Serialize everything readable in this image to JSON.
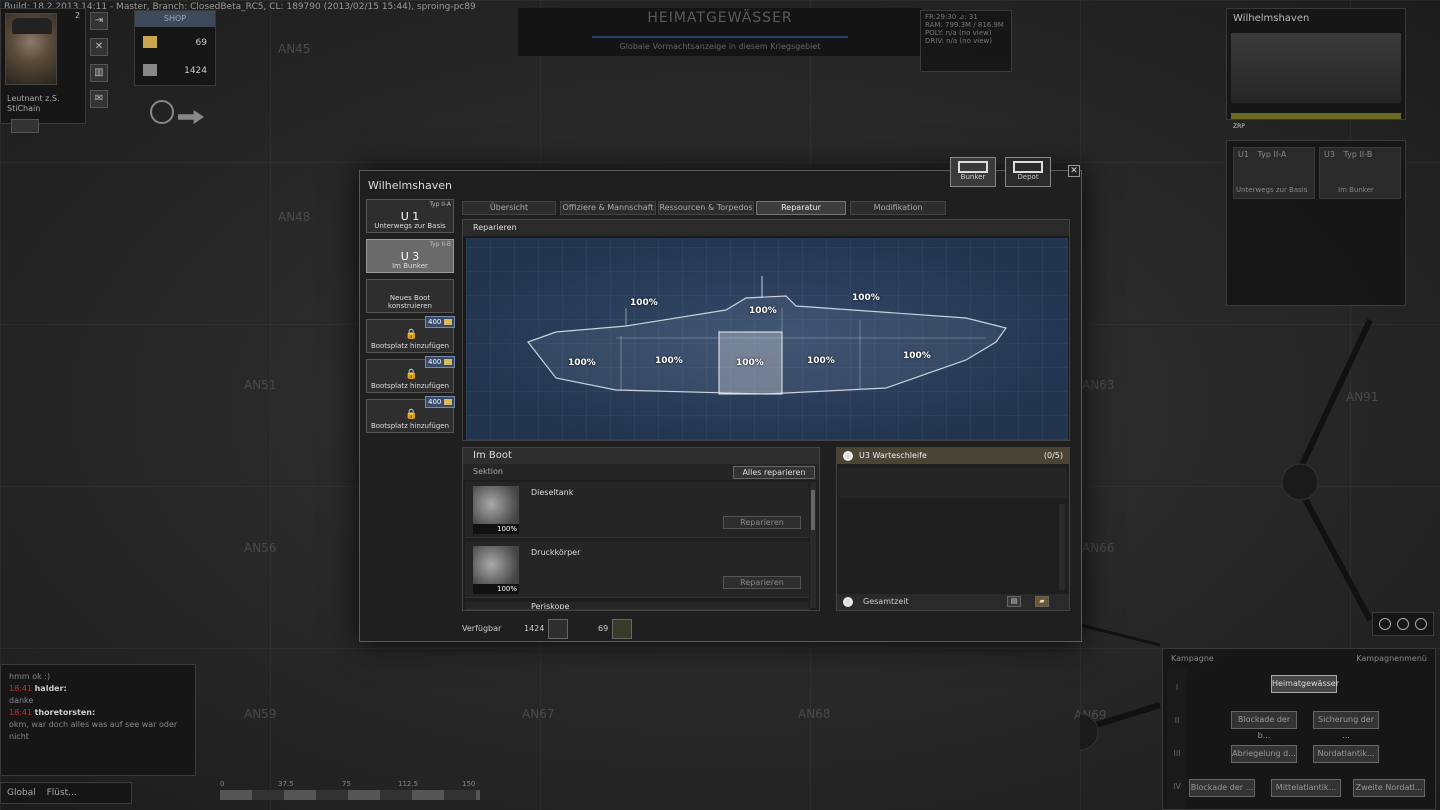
{
  "build_info": "Build: 18.2.2013 14:11 - Master, Branch: ClosedBeta_RC5, CL: 189790 (2013/02/15 15:44), sproing-pc89",
  "map": {
    "labels": [
      "AN45",
      "AN48",
      "AN51",
      "AN56",
      "AN59",
      "AN67",
      "AN68",
      "AN63",
      "AN66",
      "AN91",
      "AN69"
    ]
  },
  "officer": {
    "rank": "Leutnant z.S.",
    "name": "StiChain",
    "level": "2"
  },
  "shop": {
    "tab": "SHOP",
    "gold": "69",
    "credits": "1424"
  },
  "region": {
    "title": "HEIMATGEWÄSSER",
    "subtitle": "Globale Vormachtsanzeige in diesem Kriegsgebiet"
  },
  "debug": {
    "lines": [
      "FR:29:30  ⊿: 31",
      "",
      "RAM:   799.3M / 816.9M",
      "POLY:  n/a (no view)",
      "DRIV:  n/a (no view)"
    ]
  },
  "port_panel": {
    "title": "Wilhelmshaven",
    "bar_label": "ZRP"
  },
  "boats_panel": {
    "cards": [
      {
        "id": "U1",
        "type": "Typ II-A",
        "status": "Unterwegs zur Basis"
      },
      {
        "id": "U3",
        "type": "Typ II-B",
        "status": "Im Bunker"
      }
    ]
  },
  "chat": {
    "lines": [
      {
        "time": "",
        "name": "",
        "text": "hmm ok :)"
      },
      {
        "time": "18:41",
        "name": "halder:",
        "text": ""
      },
      {
        "time": "",
        "name": "",
        "text": "danke"
      },
      {
        "time": "18:41",
        "name": "thoretorsten:",
        "text": ""
      },
      {
        "time": "",
        "name": "",
        "text": "okm, war doch alles was auf see war oder nicht"
      }
    ],
    "tab_global": "Global",
    "tab_whisper": "Flüst..."
  },
  "scale_labels": [
    "0",
    "37.5",
    "75",
    "112.5",
    "150"
  ],
  "campaign": {
    "header": "Kampagne",
    "menu": "Kampagnenmenü",
    "levels": [
      "I",
      "II",
      "III",
      "IV"
    ],
    "nodes": [
      "Heimatgewässer",
      "Blockade der b...",
      "Sicherung der ...",
      "Abriegelung d...",
      "Nordatlantik...",
      "Blockade der ...",
      "Mittelatlantik...",
      "Zweite Nordatl..."
    ]
  },
  "modal": {
    "title": "Wilhelmshaven",
    "bunker_label": "Bunker",
    "depot_label": "Depot",
    "close": "✕",
    "boats": [
      {
        "type": "Typ II-A",
        "id": "U 1",
        "status": "Unterwegs zur Basis",
        "selected": false
      },
      {
        "type": "Typ II-B",
        "id": "U 3",
        "status": "Im Bunker",
        "selected": true
      }
    ],
    "new_boat": "Neues Boot konstruieren",
    "slots": [
      {
        "cost": "400",
        "label": "Bootsplatz hinzufügen"
      },
      {
        "cost": "400",
        "label": "Bootsplatz hinzufügen"
      },
      {
        "cost": "400",
        "label": "Bootsplatz hinzufügen"
      }
    ],
    "tabs": [
      "Übersicht",
      "Offiziere & Mannschaft",
      "Ressourcen & Torpedos",
      "Reparatur",
      "Modifikation"
    ],
    "active_tab": "Reparatur",
    "repair_header": "Reparieren",
    "hull_percents": [
      "100%",
      "100%",
      "100%",
      "100%",
      "100%",
      "100%",
      "100%",
      "100%"
    ],
    "in_boat": {
      "title": "Im Boot",
      "section_label": "Sektion",
      "repair_all": "Alles reparieren",
      "sections": [
        {
          "name": "Dieseltank",
          "pct": "100%",
          "button": "Reparieren"
        },
        {
          "name": "Druckkörper",
          "pct": "100%",
          "button": "Reparieren"
        },
        {
          "name": "Periskope",
          "pct": "",
          "button": ""
        }
      ]
    },
    "queue": {
      "title": "U3 Warteschleife",
      "count": "(0/5)",
      "total_label": "Gesamtzeit"
    },
    "footer": {
      "available_label": "Verfügbar",
      "credits": "1424",
      "gold": "69"
    }
  }
}
